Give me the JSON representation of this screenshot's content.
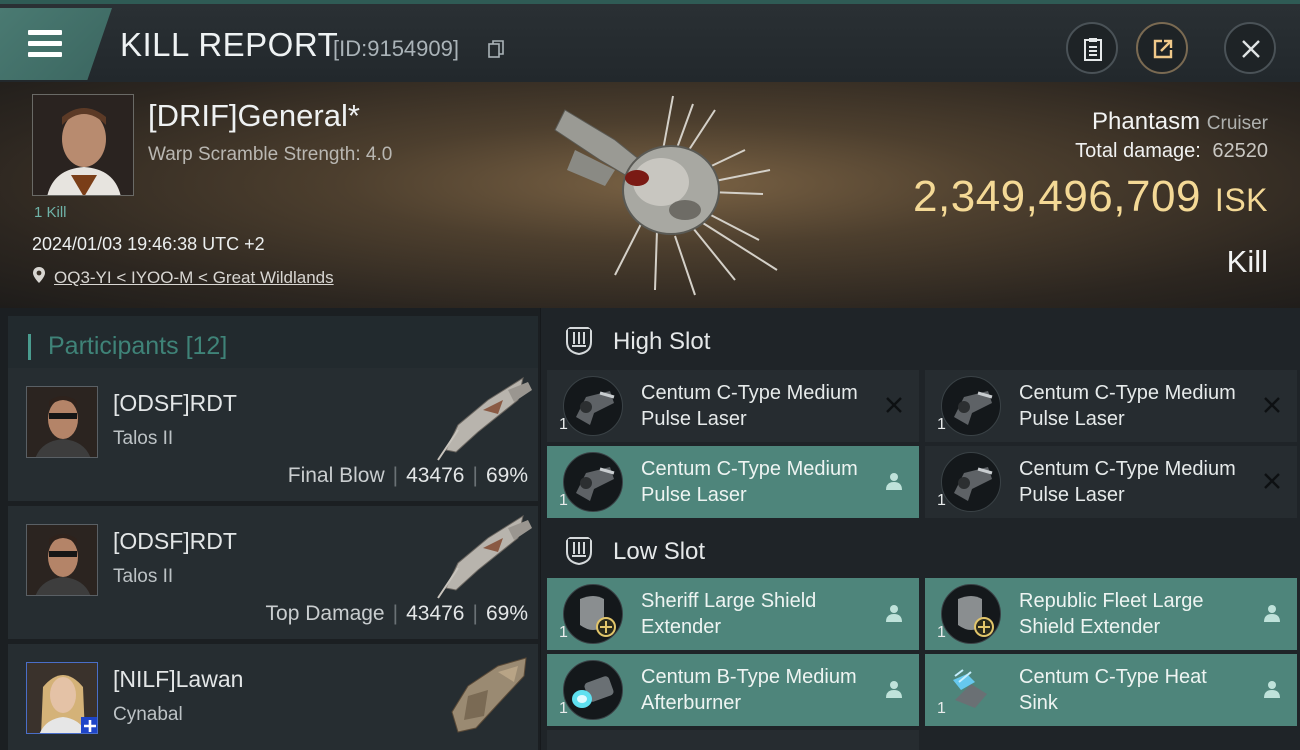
{
  "header": {
    "title": "KILL REPORT",
    "report_id": "[ID:9154909]"
  },
  "victim": {
    "name": "[DRIF]General*",
    "warp_scramble": "Warp Scramble Strength: 4.0",
    "kills": "1 Kill",
    "timestamp": "2024/01/03 19:46:38 UTC +2",
    "location": "OQ3-YI < IYOO-M < Great Wildlands",
    "ship_name": "Phantasm",
    "ship_class": "Cruiser",
    "total_damage_label": "Total damage:",
    "total_damage": "62520",
    "isk_value": "2,349,496,709",
    "isk_unit": "ISK",
    "result": "Kill"
  },
  "participants": {
    "title": "Participants",
    "count": "[12]",
    "rows": [
      {
        "name": "[ODSF]RDT",
        "ship": "Talos II",
        "label": "Final Blow",
        "damage": "43476",
        "percent": "69%"
      },
      {
        "name": "[ODSF]RDT",
        "ship": "Talos II",
        "label": "Top Damage",
        "damage": "43476",
        "percent": "69%"
      },
      {
        "name": "[NILF]Lawan",
        "ship": "Cynabal",
        "label": "",
        "damage": "",
        "percent": ""
      }
    ]
  },
  "slots": {
    "high": {
      "title": "High Slot",
      "modules": [
        {
          "name": "Centum C-Type Medium Pulse Laser",
          "qty": "1",
          "status": "destroyed"
        },
        {
          "name": "Centum C-Type Medium Pulse Laser",
          "qty": "1",
          "status": "destroyed"
        },
        {
          "name": "Centum C-Type Medium Pulse Laser",
          "qty": "1",
          "status": "dropped"
        },
        {
          "name": "Centum C-Type Medium Pulse Laser",
          "qty": "1",
          "status": "destroyed"
        }
      ]
    },
    "low": {
      "title": "Low Slot",
      "modules": [
        {
          "name": "Sheriff Large Shield Extender",
          "qty": "1",
          "status": "dropped"
        },
        {
          "name": "Republic Fleet Large Shield Extender",
          "qty": "1",
          "status": "dropped"
        },
        {
          "name": "Centum B-Type Medium Afterburner",
          "qty": "1",
          "status": "dropped"
        },
        {
          "name": "Centum C-Type Heat Sink",
          "qty": "1",
          "status": "dropped"
        }
      ]
    }
  },
  "colors": {
    "accent_teal": "#4e857b",
    "isk_gold": "#f4d996",
    "header_teal": "#4a7a72"
  },
  "icons": [
    "menu-icon",
    "copy-icon",
    "clipboard-icon",
    "share-icon",
    "close-icon",
    "location-pin-icon",
    "person-icon",
    "x-icon",
    "slot-icon"
  ]
}
